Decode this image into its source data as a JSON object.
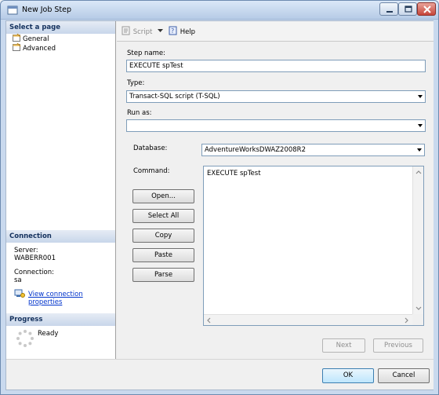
{
  "window": {
    "title": "New Job Step"
  },
  "left_pane": {
    "select_page_header": "Select a page",
    "pages": [
      {
        "label": "General",
        "icon": "page-icon"
      },
      {
        "label": "Advanced",
        "icon": "page-icon"
      }
    ],
    "connection_header": "Connection",
    "server_label": "Server:",
    "server_value": "WABERR001",
    "connection_label": "Connection:",
    "connection_value": "sa",
    "view_connection_link": "View connection properties",
    "progress_header": "Progress",
    "progress_status": "Ready"
  },
  "toolbar": {
    "script_label": "Script",
    "help_label": "Help"
  },
  "form": {
    "step_name_label": "Step name:",
    "step_name_value": "EXECUTE spTest",
    "type_label": "Type:",
    "type_value": "Transact-SQL script (T-SQL)",
    "run_as_label": "Run as:",
    "run_as_value": "",
    "database_label": "Database:",
    "database_value": "AdventureWorksDWAZ2008R2",
    "command_label": "Command:",
    "command_value": "EXECUTE spTest",
    "open_button": "Open...",
    "select_all_button": "Select All",
    "copy_button": "Copy",
    "paste_button": "Paste",
    "parse_button": "Parse"
  },
  "nav": {
    "next_button": "Next",
    "previous_button": "Previous"
  },
  "dialog_buttons": {
    "ok": "OK",
    "cancel": "Cancel"
  }
}
